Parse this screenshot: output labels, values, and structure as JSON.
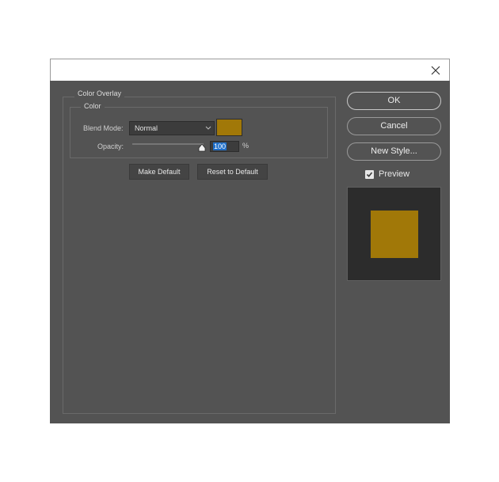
{
  "window": {
    "close_icon": "close-icon"
  },
  "panel": {
    "group_title": "Color Overlay",
    "sub_group_title": "Color",
    "blend_mode": {
      "label": "Blend Mode:",
      "value": "Normal"
    },
    "overlay_color": "#a17808",
    "opacity": {
      "label": "Opacity:",
      "value": "100",
      "unit": "%",
      "slider_value_percent": 100
    },
    "make_default_label": "Make Default",
    "reset_default_label": "Reset to Default"
  },
  "side": {
    "ok_label": "OK",
    "cancel_label": "Cancel",
    "new_style_label": "New Style...",
    "preview_label": "Preview",
    "preview_checked": true
  },
  "colors": {
    "dialog_bg": "#535353",
    "preview_bg": "#2c2c2c"
  }
}
